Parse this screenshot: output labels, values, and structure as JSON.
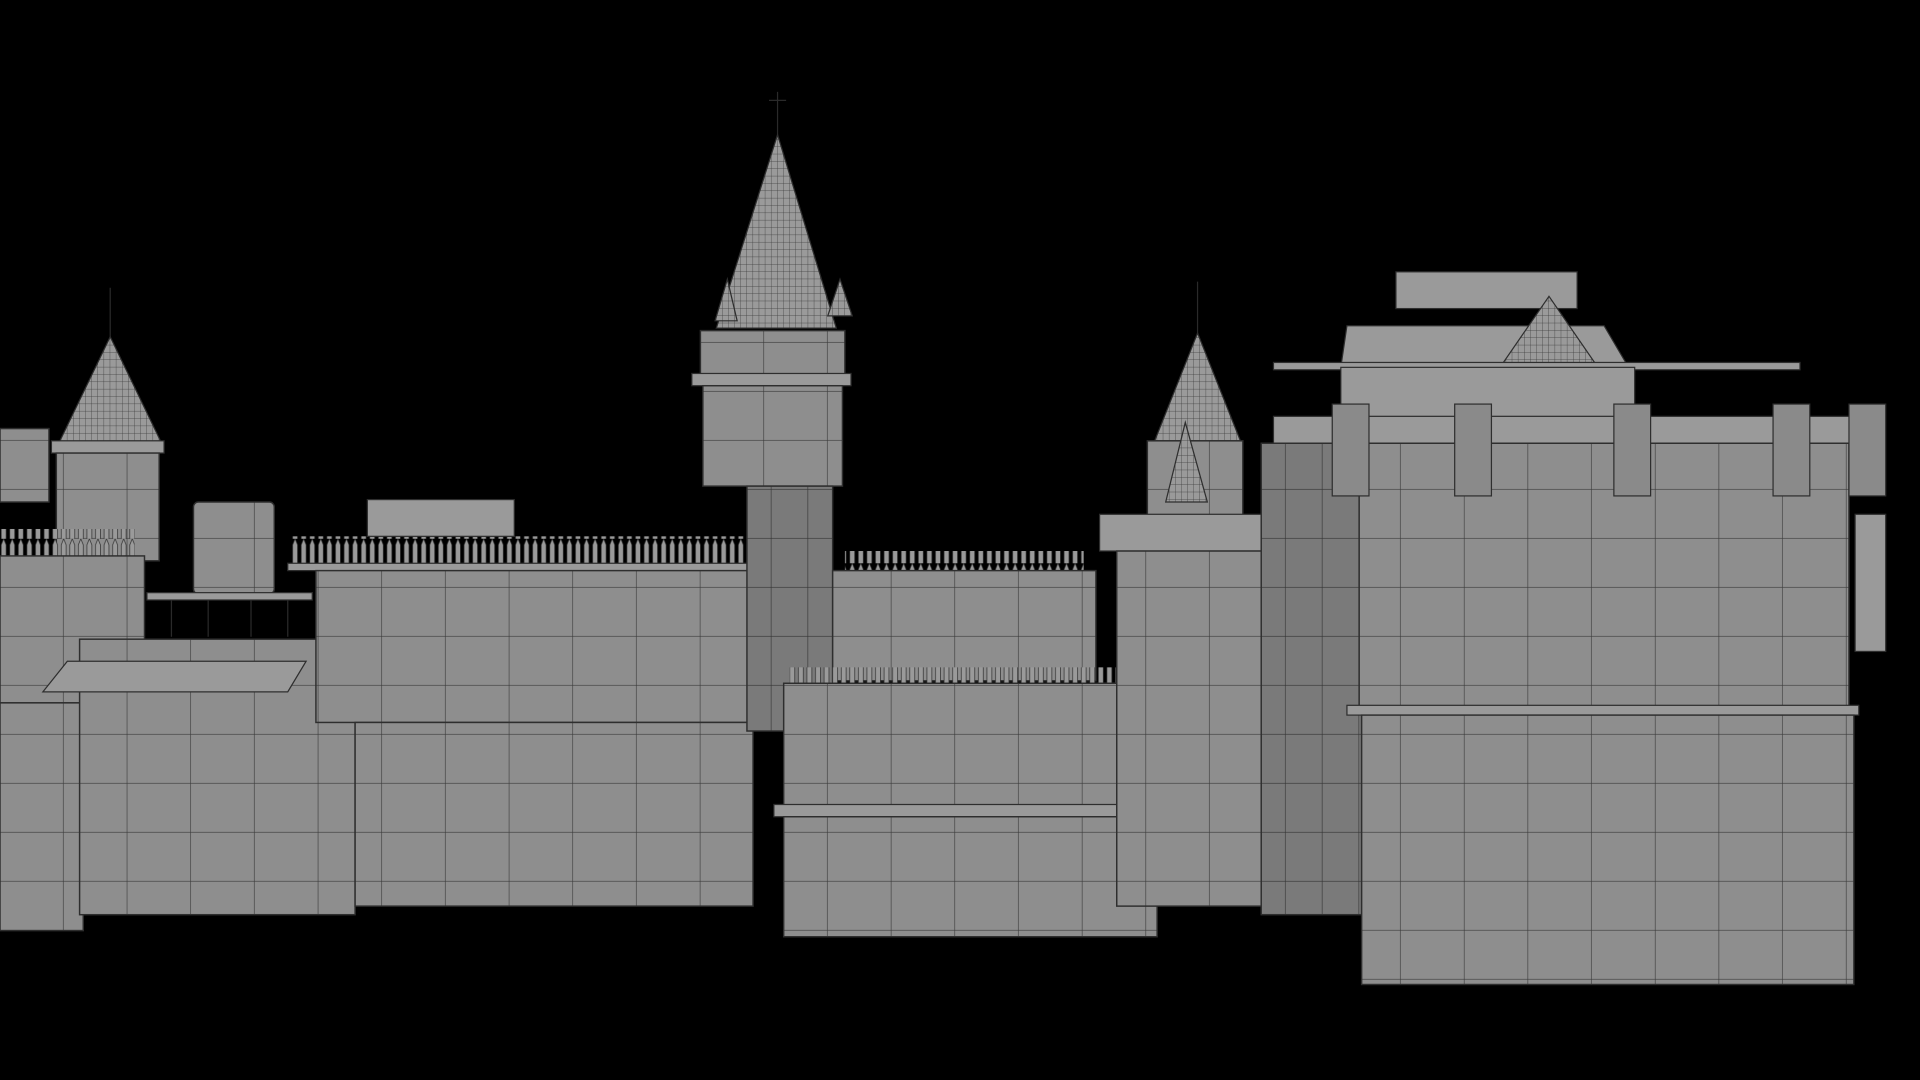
{
  "scene": {
    "background": "#000000",
    "model_color": "#8c8c8c",
    "wire_color": "#2e2e2e"
  }
}
